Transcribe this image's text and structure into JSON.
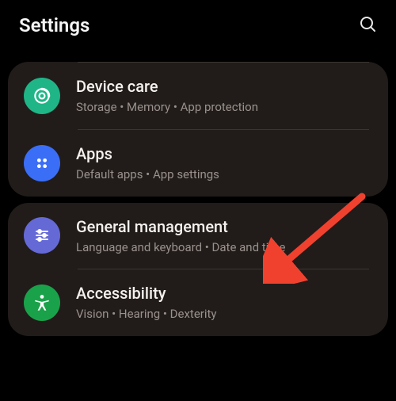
{
  "header": {
    "title": "Settings"
  },
  "groups": [
    {
      "items": [
        {
          "title": "Device care",
          "subtitle": "Storage  •  Memory  •  App protection"
        },
        {
          "title": "Apps",
          "subtitle": "Default apps  •  App settings"
        }
      ]
    },
    {
      "items": [
        {
          "title": "General management",
          "subtitle": "Language and keyboard  •  Date and time"
        },
        {
          "title": "Accessibility",
          "subtitle": "Vision  •  Hearing  •  Dexterity"
        }
      ]
    }
  ]
}
